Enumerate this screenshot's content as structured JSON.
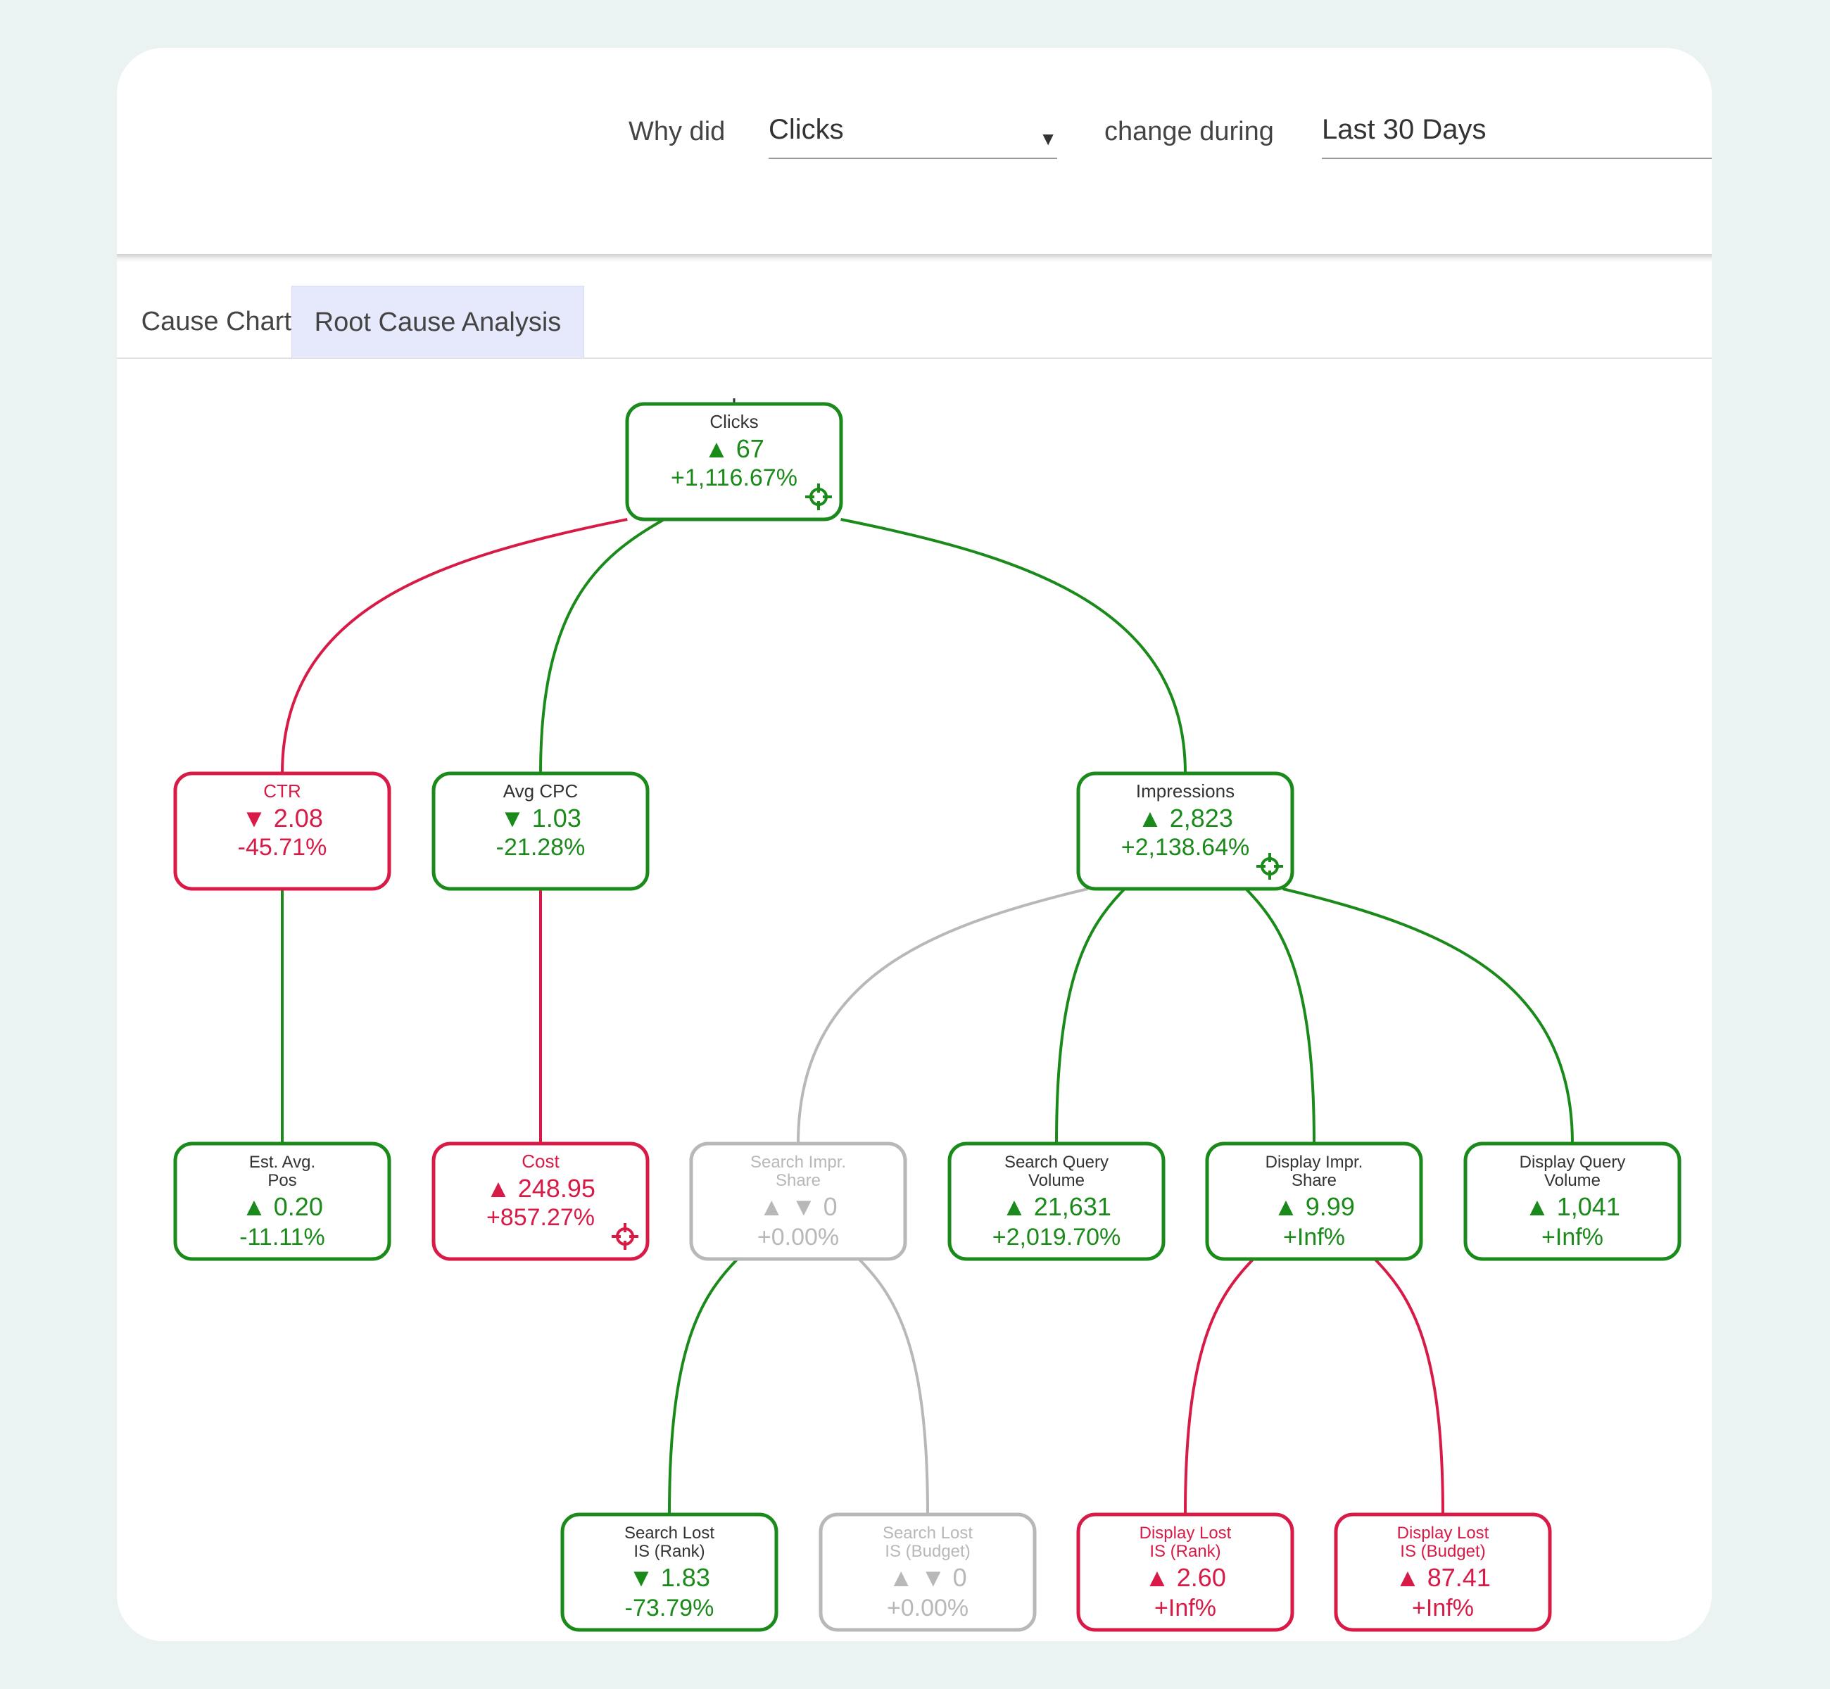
{
  "toolbar": {
    "why_label": "Why did",
    "metric_value": "Clicks",
    "change_label": "change during",
    "period_value": "Last 30 Days"
  },
  "tabs": [
    {
      "label": "Cause Chart",
      "active": false
    },
    {
      "label": "Root Cause Analysis",
      "active": true
    }
  ],
  "colors": {
    "positive": "#1a8a1a",
    "negative": "#d81b46",
    "neutral": "#b8b8b8"
  },
  "tree": {
    "nodes": [
      {
        "id": "clicks",
        "label": [
          "Clicks"
        ],
        "arrow": "▲",
        "value": "67",
        "change": "+1,116.67%",
        "status": "positive",
        "focus": true
      },
      {
        "id": "ctr",
        "label": [
          "CTR"
        ],
        "arrow": "▼",
        "value": "2.08",
        "change": "-45.71%",
        "status": "negative",
        "focus": false
      },
      {
        "id": "avgcpc",
        "label": [
          "Avg CPC"
        ],
        "arrow": "▼",
        "value": "1.03",
        "change": "-21.28%",
        "status": "positive",
        "focus": false
      },
      {
        "id": "impressions",
        "label": [
          "Impressions"
        ],
        "arrow": "▲",
        "value": "2,823",
        "change": "+2,138.64%",
        "status": "positive",
        "focus": true
      },
      {
        "id": "estavgpos",
        "label": [
          "Est. Avg.",
          "Pos"
        ],
        "arrow": "▲",
        "value": "0.20",
        "change": "-11.11%",
        "status": "positive",
        "focus": false
      },
      {
        "id": "cost",
        "label": [
          "Cost"
        ],
        "arrow": "▲",
        "value": "248.95",
        "change": "+857.27%",
        "status": "negative",
        "focus": true
      },
      {
        "id": "searchimpr",
        "label": [
          "Search Impr.",
          "Share"
        ],
        "arrow": "▲ ▼",
        "value": "0",
        "change": "+0.00%",
        "status": "neutral",
        "focus": false
      },
      {
        "id": "searchquery",
        "label": [
          "Search Query",
          "Volume"
        ],
        "arrow": "▲",
        "value": "21,631",
        "change": "+2,019.70%",
        "status": "positive",
        "focus": false
      },
      {
        "id": "displayimpr",
        "label": [
          "Display Impr.",
          "Share"
        ],
        "arrow": "▲",
        "value": "9.99",
        "change": "+Inf%",
        "status": "positive",
        "focus": false
      },
      {
        "id": "displayquery",
        "label": [
          "Display Query",
          "Volume"
        ],
        "arrow": "▲",
        "value": "1,041",
        "change": "+Inf%",
        "status": "positive",
        "focus": false
      },
      {
        "id": "searchlostrank",
        "label": [
          "Search Lost",
          "IS (Rank)"
        ],
        "arrow": "▼",
        "value": "1.83",
        "change": "-73.79%",
        "status": "positive",
        "focus": false
      },
      {
        "id": "searchlostbudget",
        "label": [
          "Search Lost",
          "IS (Budget)"
        ],
        "arrow": "▲ ▼",
        "value": "0",
        "change": "+0.00%",
        "status": "neutral",
        "focus": false
      },
      {
        "id": "displaylostrank",
        "label": [
          "Display Lost",
          "IS (Rank)"
        ],
        "arrow": "▲",
        "value": "2.60",
        "change": "+Inf%",
        "status": "negative",
        "focus": false
      },
      {
        "id": "displaylostbudget",
        "label": [
          "Display Lost",
          "IS (Budget)"
        ],
        "arrow": "▲",
        "value": "87.41",
        "change": "+Inf%",
        "status": "negative",
        "focus": false
      }
    ],
    "edges": [
      {
        "from": "clicks",
        "to": "ctr",
        "status": "negative"
      },
      {
        "from": "clicks",
        "to": "avgcpc",
        "status": "positive"
      },
      {
        "from": "clicks",
        "to": "impressions",
        "status": "positive"
      },
      {
        "from": "ctr",
        "to": "estavgpos",
        "status": "positive"
      },
      {
        "from": "avgcpc",
        "to": "cost",
        "status": "negative"
      },
      {
        "from": "impressions",
        "to": "searchimpr",
        "status": "neutral"
      },
      {
        "from": "impressions",
        "to": "searchquery",
        "status": "positive"
      },
      {
        "from": "impressions",
        "to": "displayimpr",
        "status": "positive"
      },
      {
        "from": "impressions",
        "to": "displayquery",
        "status": "positive"
      },
      {
        "from": "searchimpr",
        "to": "searchlostrank",
        "status": "positive"
      },
      {
        "from": "searchimpr",
        "to": "searchlostbudget",
        "status": "neutral"
      },
      {
        "from": "displayimpr",
        "to": "displaylostrank",
        "status": "negative"
      },
      {
        "from": "displayimpr",
        "to": "displaylostbudget",
        "status": "negative"
      }
    ]
  }
}
